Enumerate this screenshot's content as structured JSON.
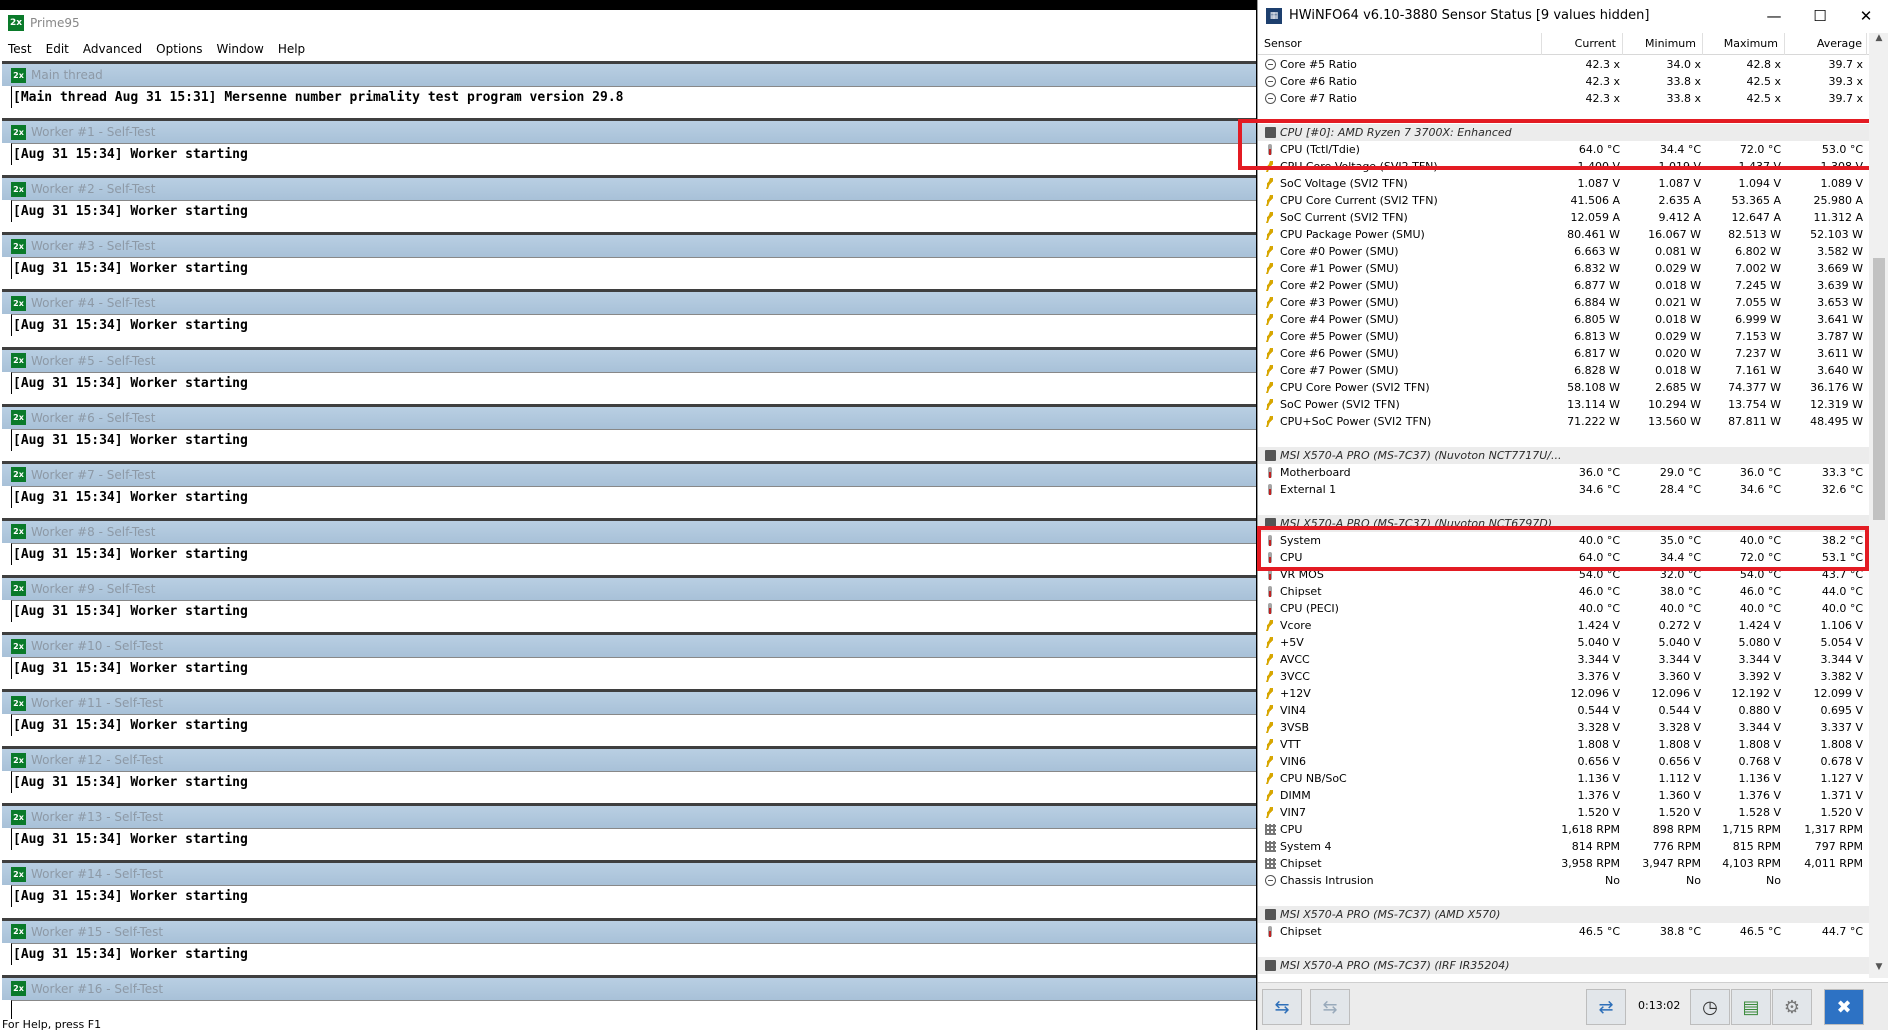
{
  "prime": {
    "title": "Prime95",
    "app_icon": "2x",
    "menu": [
      "Test",
      "Edit",
      "Advanced",
      "Options",
      "Window",
      "Help"
    ],
    "windows": [
      {
        "caption": "Main thread",
        "line": "[Main thread Aug 31 15:31] Mersenne number primality test program version 29.8"
      },
      {
        "caption": "Worker #1 - Self-Test",
        "line": "[Aug 31 15:34] Worker starting"
      },
      {
        "caption": "Worker #2 - Self-Test",
        "line": "[Aug 31 15:34] Worker starting"
      },
      {
        "caption": "Worker #3 - Self-Test",
        "line": "[Aug 31 15:34] Worker starting"
      },
      {
        "caption": "Worker #4 - Self-Test",
        "line": "[Aug 31 15:34] Worker starting"
      },
      {
        "caption": "Worker #5 - Self-Test",
        "line": "[Aug 31 15:34] Worker starting"
      },
      {
        "caption": "Worker #6 - Self-Test",
        "line": "[Aug 31 15:34] Worker starting"
      },
      {
        "caption": "Worker #7 - Self-Test",
        "line": "[Aug 31 15:34] Worker starting"
      },
      {
        "caption": "Worker #8 - Self-Test",
        "line": "[Aug 31 15:34] Worker starting"
      },
      {
        "caption": "Worker #9 - Self-Test",
        "line": "[Aug 31 15:34] Worker starting"
      },
      {
        "caption": "Worker #10 - Self-Test",
        "line": "[Aug 31 15:34] Worker starting"
      },
      {
        "caption": "Worker #11 - Self-Test",
        "line": "[Aug 31 15:34] Worker starting"
      },
      {
        "caption": "Worker #12 - Self-Test",
        "line": "[Aug 31 15:34] Worker starting"
      },
      {
        "caption": "Worker #13 - Self-Test",
        "line": "[Aug 31 15:34] Worker starting"
      },
      {
        "caption": "Worker #14 - Self-Test",
        "line": "[Aug 31 15:34] Worker starting"
      },
      {
        "caption": "Worker #15 - Self-Test",
        "line": "[Aug 31 15:34] Worker starting"
      },
      {
        "caption": "Worker #16 - Self-Test",
        "line": ""
      }
    ],
    "status": "For Help, press F1"
  },
  "hw": {
    "title": "HWiNFO64 v6.10-3880 Sensor Status [9 values hidden]",
    "columns": [
      "Sensor",
      "Current",
      "Minimum",
      "Maximum",
      "Average"
    ],
    "rows": [
      {
        "ic": "c",
        "name": "Core #5 Ratio",
        "cur": "42.3 x",
        "min": "34.0 x",
        "max": "42.8 x",
        "avg": "39.7 x"
      },
      {
        "ic": "c",
        "name": "Core #6 Ratio",
        "cur": "42.3 x",
        "min": "33.8 x",
        "max": "42.5 x",
        "avg": "39.3 x"
      },
      {
        "ic": "c",
        "name": "Core #7 Ratio",
        "cur": "42.3 x",
        "min": "33.8 x",
        "max": "42.5 x",
        "avg": "39.7 x"
      },
      {
        "blank": true
      },
      {
        "hdr": true,
        "name": "CPU [#0]: AMD Ryzen 7 3700X: Enhanced"
      },
      {
        "ic": "t",
        "name": "CPU (Tctl/Tdie)",
        "cur": "64.0 °C",
        "min": "34.4 °C",
        "max": "72.0 °C",
        "avg": "53.0 °C"
      },
      {
        "ic": "v",
        "name": "CPU Core Voltage (SVI2 TFN)",
        "cur": "1.400 V",
        "min": "1.019 V",
        "max": "1.437 V",
        "avg": "1.308 V"
      },
      {
        "ic": "v",
        "name": "SoC Voltage (SVI2 TFN)",
        "cur": "1.087 V",
        "min": "1.087 V",
        "max": "1.094 V",
        "avg": "1.089 V"
      },
      {
        "ic": "v",
        "name": "CPU Core Current (SVI2 TFN)",
        "cur": "41.506 A",
        "min": "2.635 A",
        "max": "53.365 A",
        "avg": "25.980 A"
      },
      {
        "ic": "v",
        "name": "SoC Current (SVI2 TFN)",
        "cur": "12.059 A",
        "min": "9.412 A",
        "max": "12.647 A",
        "avg": "11.312 A"
      },
      {
        "ic": "v",
        "name": "CPU Package Power (SMU)",
        "cur": "80.461 W",
        "min": "16.067 W",
        "max": "82.513 W",
        "avg": "52.103 W"
      },
      {
        "ic": "v",
        "name": "Core #0 Power (SMU)",
        "cur": "6.663 W",
        "min": "0.081 W",
        "max": "6.802 W",
        "avg": "3.582 W"
      },
      {
        "ic": "v",
        "name": "Core #1 Power (SMU)",
        "cur": "6.832 W",
        "min": "0.029 W",
        "max": "7.002 W",
        "avg": "3.669 W"
      },
      {
        "ic": "v",
        "name": "Core #2 Power (SMU)",
        "cur": "6.877 W",
        "min": "0.018 W",
        "max": "7.245 W",
        "avg": "3.639 W"
      },
      {
        "ic": "v",
        "name": "Core #3 Power (SMU)",
        "cur": "6.884 W",
        "min": "0.021 W",
        "max": "7.055 W",
        "avg": "3.653 W"
      },
      {
        "ic": "v",
        "name": "Core #4 Power (SMU)",
        "cur": "6.805 W",
        "min": "0.018 W",
        "max": "6.999 W",
        "avg": "3.641 W"
      },
      {
        "ic": "v",
        "name": "Core #5 Power (SMU)",
        "cur": "6.813 W",
        "min": "0.029 W",
        "max": "7.153 W",
        "avg": "3.787 W"
      },
      {
        "ic": "v",
        "name": "Core #6 Power (SMU)",
        "cur": "6.817 W",
        "min": "0.020 W",
        "max": "7.237 W",
        "avg": "3.611 W"
      },
      {
        "ic": "v",
        "name": "Core #7 Power (SMU)",
        "cur": "6.828 W",
        "min": "0.018 W",
        "max": "7.161 W",
        "avg": "3.640 W"
      },
      {
        "ic": "v",
        "name": "CPU Core Power (SVI2 TFN)",
        "cur": "58.108 W",
        "min": "2.685 W",
        "max": "74.377 W",
        "avg": "36.176 W"
      },
      {
        "ic": "v",
        "name": "SoC Power (SVI2 TFN)",
        "cur": "13.114 W",
        "min": "10.294 W",
        "max": "13.754 W",
        "avg": "12.319 W"
      },
      {
        "ic": "v",
        "name": "CPU+SoC Power (SVI2 TFN)",
        "cur": "71.222 W",
        "min": "13.560 W",
        "max": "87.811 W",
        "avg": "48.495 W"
      },
      {
        "blank": true
      },
      {
        "hdr": true,
        "name": "MSI X570-A PRO (MS-7C37) (Nuvoton NCT7717U/..."
      },
      {
        "ic": "t",
        "name": "Motherboard",
        "cur": "36.0 °C",
        "min": "29.0 °C",
        "max": "36.0 °C",
        "avg": "33.3 °C"
      },
      {
        "ic": "t",
        "name": "External 1",
        "cur": "34.6 °C",
        "min": "28.4 °C",
        "max": "34.6 °C",
        "avg": "32.6 °C"
      },
      {
        "blank": true
      },
      {
        "hdr": true,
        "name": "MSI X570-A PRO (MS-7C37) (Nuvoton NCT6797D)"
      },
      {
        "ic": "t",
        "name": "System",
        "cur": "40.0 °C",
        "min": "35.0 °C",
        "max": "40.0 °C",
        "avg": "38.2 °C"
      },
      {
        "ic": "t",
        "name": "CPU",
        "cur": "64.0 °C",
        "min": "34.4 °C",
        "max": "72.0 °C",
        "avg": "53.1 °C"
      },
      {
        "ic": "t",
        "name": "VR MOS",
        "cur": "54.0 °C",
        "min": "32.0 °C",
        "max": "54.0 °C",
        "avg": "43.7 °C"
      },
      {
        "ic": "t",
        "name": "Chipset",
        "cur": "46.0 °C",
        "min": "38.0 °C",
        "max": "46.0 °C",
        "avg": "44.0 °C"
      },
      {
        "ic": "t",
        "name": "CPU (PECI)",
        "cur": "40.0 °C",
        "min": "40.0 °C",
        "max": "40.0 °C",
        "avg": "40.0 °C"
      },
      {
        "ic": "v",
        "name": "Vcore",
        "cur": "1.424 V",
        "min": "0.272 V",
        "max": "1.424 V",
        "avg": "1.106 V"
      },
      {
        "ic": "v",
        "name": "+5V",
        "cur": "5.040 V",
        "min": "5.040 V",
        "max": "5.080 V",
        "avg": "5.054 V"
      },
      {
        "ic": "v",
        "name": "AVCC",
        "cur": "3.344 V",
        "min": "3.344 V",
        "max": "3.344 V",
        "avg": "3.344 V"
      },
      {
        "ic": "v",
        "name": "3VCC",
        "cur": "3.376 V",
        "min": "3.360 V",
        "max": "3.392 V",
        "avg": "3.382 V"
      },
      {
        "ic": "v",
        "name": "+12V",
        "cur": "12.096 V",
        "min": "12.096 V",
        "max": "12.192 V",
        "avg": "12.099 V"
      },
      {
        "ic": "v",
        "name": "VIN4",
        "cur": "0.544 V",
        "min": "0.544 V",
        "max": "0.880 V",
        "avg": "0.695 V"
      },
      {
        "ic": "v",
        "name": "3VSB",
        "cur": "3.328 V",
        "min": "3.328 V",
        "max": "3.344 V",
        "avg": "3.337 V"
      },
      {
        "ic": "v",
        "name": "VTT",
        "cur": "1.808 V",
        "min": "1.808 V",
        "max": "1.808 V",
        "avg": "1.808 V"
      },
      {
        "ic": "v",
        "name": "VIN6",
        "cur": "0.656 V",
        "min": "0.656 V",
        "max": "0.768 V",
        "avg": "0.678 V"
      },
      {
        "ic": "v",
        "name": "CPU NB/SoC",
        "cur": "1.136 V",
        "min": "1.112 V",
        "max": "1.136 V",
        "avg": "1.127 V"
      },
      {
        "ic": "v",
        "name": "DIMM",
        "cur": "1.376 V",
        "min": "1.360 V",
        "max": "1.376 V",
        "avg": "1.371 V"
      },
      {
        "ic": "v",
        "name": "VIN7",
        "cur": "1.520 V",
        "min": "1.520 V",
        "max": "1.528 V",
        "avg": "1.520 V"
      },
      {
        "ic": "f",
        "name": "CPU",
        "cur": "1,618 RPM",
        "min": "898 RPM",
        "max": "1,715 RPM",
        "avg": "1,317 RPM"
      },
      {
        "ic": "f",
        "name": "System 4",
        "cur": "814 RPM",
        "min": "776 RPM",
        "max": "815 RPM",
        "avg": "797 RPM"
      },
      {
        "ic": "f",
        "name": "Chipset",
        "cur": "3,958 RPM",
        "min": "3,947 RPM",
        "max": "4,103 RPM",
        "avg": "4,011 RPM"
      },
      {
        "ic": "c",
        "name": "Chassis Intrusion",
        "cur": "No",
        "min": "No",
        "max": "No",
        "avg": ""
      },
      {
        "blank": true
      },
      {
        "hdr": true,
        "name": "MSI X570-A PRO (MS-7C37) (AMD X570)"
      },
      {
        "ic": "t",
        "name": "Chipset",
        "cur": "46.5 °C",
        "min": "38.8 °C",
        "max": "46.5 °C",
        "avg": "44.7 °C"
      },
      {
        "blank": true
      },
      {
        "hdr": true,
        "name": "MSI X570-A PRO (MS-7C37) (IRF IR35204)"
      }
    ],
    "elapsed": "0:13:02",
    "highlight_color": "#e31b23"
  }
}
